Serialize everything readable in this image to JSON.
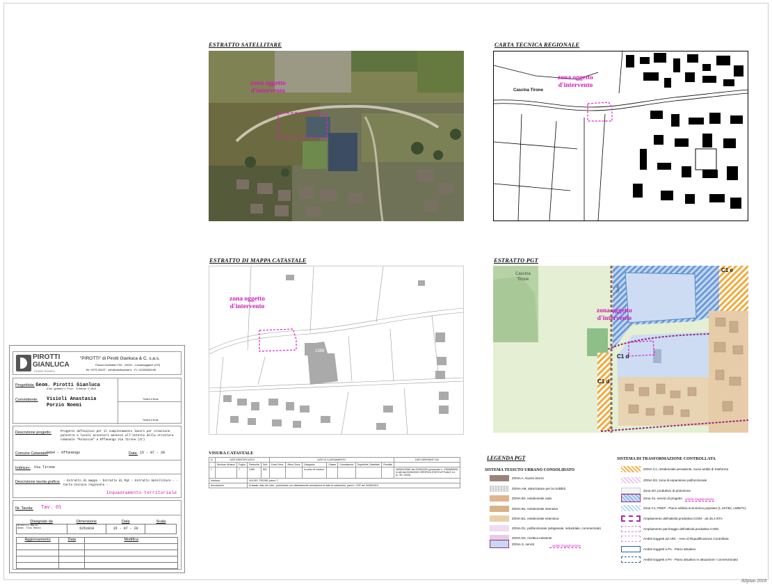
{
  "corner_text": "Allplan 2018",
  "panels": {
    "satellite": {
      "title": "ESTRATTO SATELLITARE",
      "zone_label_1": "zona oggetto",
      "zone_label_2": "d'intervento"
    },
    "ctr": {
      "title": "CARTA TECNICA REGIONALE",
      "zone_label_1": "zona oggetto",
      "zone_label_2": "d'intervento",
      "place_label": "Cascina Tirone"
    },
    "cadastral": {
      "title": "ESTRATTO DI MAPPA CATASTALE",
      "zone_label_1": "zona oggetto",
      "zone_label_2": "d'intervento",
      "parcel_label": "1389"
    },
    "pgt": {
      "title": "ESTRATTO PGT",
      "zone_label_1": "zona oggetto",
      "zone_label_2": "d'intervento",
      "place_label_1": "Cascina",
      "place_label_2": "Tirone",
      "road_label": "Goito",
      "zone_c1e": "C1 e",
      "zone_c1d_a": "C1 d",
      "zone_c1d_b": "C1 d"
    }
  },
  "title_block": {
    "company": "\"PIROTTI\" di Pirotti Gianluca & C. s.a.s.",
    "address": "Piazza Garibaldi n°54 - 26041 - Casalmaggiore (CR)",
    "contacts": "Tel. 0375-43437 - info@studiopirotti.it - P.I. 01289450198",
    "logo_1": "PIROTTI",
    "logo_2": "GIANLUCA",
    "logo_sub": "STUDIO TECNICO",
    "progettista_label": "Progettista:",
    "progettista_value": "Geom. Pirotti Gianluca",
    "progettista_sub": "albo geometri Prov. Cremona n°1942",
    "timbro_1": "Timbro e firma",
    "committente_label": "Committente:",
    "committente_value_1": "Visioli Anastasia",
    "committente_value_2": "Porzio Noemi",
    "timbro_2": "Timbro e firma",
    "descr_label": "Descrizione progetto:",
    "descr_value": "Progetto definitivo per il completamento lavori per creazione palestra e locali accessori annessi all'interno della struttura comunale \"Palazcim\" a Offanengo Via Tirone (Cr)",
    "comune_label": "Comune Catastale:",
    "comune_value": "G004 - Offanengo",
    "data_label": "Data:",
    "data_value": "15 - 07 - 20",
    "indirizzo_label": "Indirizzo:",
    "indirizzo_value": "Via Tirone",
    "tavola_descr_label": "Descrizione tavola grafica:",
    "tavola_descr_value": "- Estratto di mappa - Estratto di Pgt - Estratto Satellitare - - Carta tecnica regionale -",
    "tavola_title": "Inquadramento territoriale",
    "nr_tavola_label": "Nr. Tavola:",
    "nr_tavola_value": "Tav. 01",
    "table_headers": [
      "Disegnato da",
      "Dimensione",
      "Data",
      "Scala"
    ],
    "table_values": [
      "Brunelli Mario\nGeom. Tini Renzo",
      "625x810",
      "15 - 07 - 20",
      ""
    ],
    "rev_headers": [
      "Aggiornamento",
      "Data",
      "Modifica"
    ]
  },
  "visura": {
    "title": "VISURA CATASTALE",
    "group_headers": [
      "DATI IDENTIFICATIVI",
      "DATI DI CLASSAMENTO",
      "DATI DERIVANTI DA"
    ],
    "col_headers": [
      "N.",
      "Sezione Urbana",
      "Foglio",
      "Particella",
      "Sub",
      "Zona Cens.",
      "Micro Zona",
      "Categoria",
      "Classe",
      "Consistenza",
      "Superficie Catastale",
      "Rendita"
    ],
    "row": [
      "1",
      "",
      "7",
      "1389",
      "501",
      "",
      "",
      "in corso di costruz.",
      "",
      "",
      "",
      "",
      "VARIAZIONE del 22/06/2020 (protocollo n. CR0089999) in atti dal 22/06/2020 VERIFICA STATO ATTUALE U.I. (n. 90 / 2020)"
    ],
    "indirizzo_label": "Indirizzo",
    "indirizzo_value": "VIA DEL TIRONE piano: T;",
    "annotazioni_label": "Annotazioni",
    "annotazioni_value": "di stadio: dato del lotto - preliminare con distintamente annotazioni di date di notamento, piani e. CRF del 29/06/2019"
  },
  "legend": {
    "title": "LEGENDA PGT",
    "left_heading": "SISTEMA TESSUTO URBANO CONSOLIDATO",
    "right_heading": "SISTEMA DI TRASFORMAZIONE CONTROLLATA",
    "left_items": [
      {
        "label": "ZONA A, Nuclei Storici",
        "color": "#9a8479"
      },
      {
        "label": "ZONA AM, attrezzature per la mobilità",
        "color": "#cfcfcf"
      },
      {
        "label": "ZONA B0, residenziale rada",
        "color": "#e1b48f"
      },
      {
        "label": "ZONA B2, residenziale intensiva",
        "color": "#d8b285"
      },
      {
        "label": "ZONA B1, residenziale estensiva",
        "color": "#e9cfaa"
      },
      {
        "label": "ZONA D1, polifunzionale (artigianale, industriale, commerciale)",
        "color": "#efdcef"
      },
      {
        "label": "ZONA D2, ricettiva esistente",
        "color": "#e6cce6"
      },
      {
        "label": "ZONA S, servizi",
        "color": "#c7d8f2"
      }
    ],
    "left_note": "ambiti d'applicazione",
    "right_items": [
      {
        "label": "ZONA C1, residenziale prevalente, nuovi ambiti di trasforma",
        "color": "#f4b04a"
      },
      {
        "label": "ZONA D3, zona di espansione polifunzionale",
        "color": "#e9c7ef"
      },
      {
        "label": "Zona D0, produttivo di protezione",
        "color": "#f5f5f5"
      },
      {
        "label": "Zona S1, servizi di progetto",
        "color": "#8fb8ea"
      },
      {
        "label": "Zona C1, PEEP - Piano edilizia economica popolare (L.167/62, L865/71)",
        "color": "#b6d6f2"
      },
      {
        "label": "Ampliamento dell'attività produttiva CO/M - art.45.4 NTA",
        "color": "#a62a9a"
      },
      {
        "label": "Ampliamento parcheggio dell'attività produttiva CO/M",
        "color": "#d887d0"
      },
      {
        "label": "Ambiti soggetti ad ARC - Aree di Riqualificazione Controllata",
        "color": "#d99ac9"
      },
      {
        "label": "Ambiti soggetti a PA - Piano attuativo",
        "color": "#2a5f9a"
      },
      {
        "label": "Ambiti soggetti a PA - Piano attuativo in attuazione / convenzionato",
        "color": "#2a5f9a"
      }
    ],
    "right_note": "ambiti d'applicazione"
  }
}
